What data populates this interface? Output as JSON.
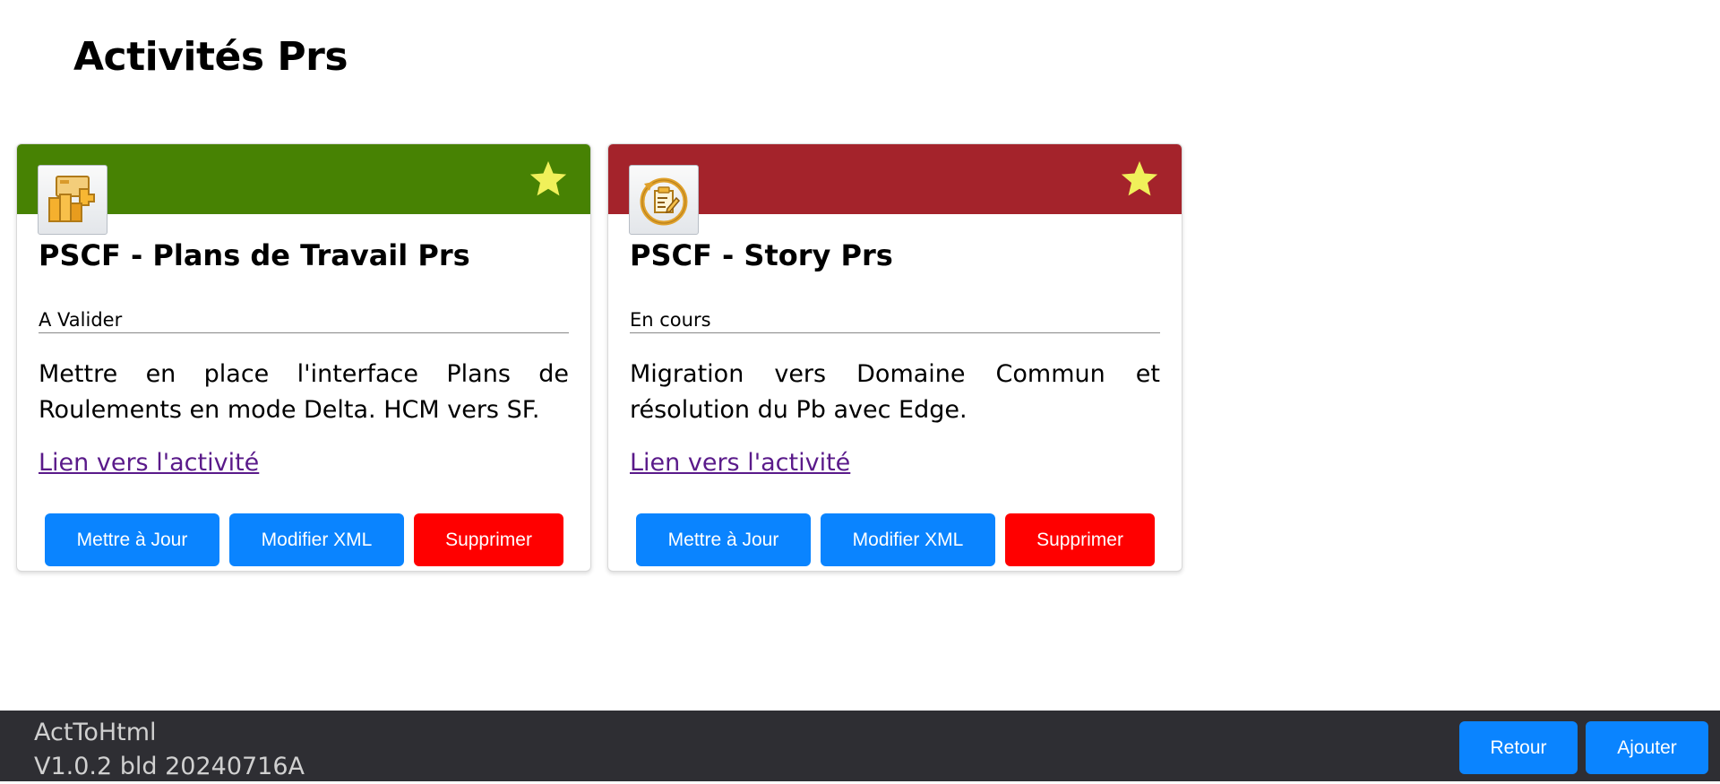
{
  "page": {
    "title": "Activités Prs"
  },
  "cards": [
    {
      "header_color": "#478203",
      "icon": "puzzle-pieces-icon",
      "favorite_icon": "star-icon",
      "title": "PSCF - Plans de Travail Prs",
      "status": "A Valider",
      "description": "Mettre en place l'interface Plans de Roulements en mode Delta. HCM vers SF.",
      "link_label": "Lien vers l'activité",
      "buttons": {
        "update": "Mettre à Jour",
        "edit_xml": "Modifier XML",
        "delete": "Supprimer"
      }
    },
    {
      "header_color": "#a4232b",
      "icon": "refresh-document-icon",
      "favorite_icon": "star-icon",
      "title": "PSCF - Story Prs",
      "status": "En cours",
      "description": "Migration vers Domaine Commun et résolution du Pb avec Edge.",
      "link_label": "Lien vers l'activité",
      "buttons": {
        "update": "Mettre à Jour",
        "edit_xml": "Modifier XML",
        "delete": "Supprimer"
      }
    }
  ],
  "footer": {
    "app_name": "ActToHtml",
    "version": "V1.0.2 bld 20240716A",
    "back_label": "Retour",
    "add_label": "Ajouter"
  },
  "colors": {
    "primary_button": "#0a84ff",
    "danger_button": "#ff0000",
    "star": "#f0f05a",
    "footer_bg": "#2e2e33"
  }
}
